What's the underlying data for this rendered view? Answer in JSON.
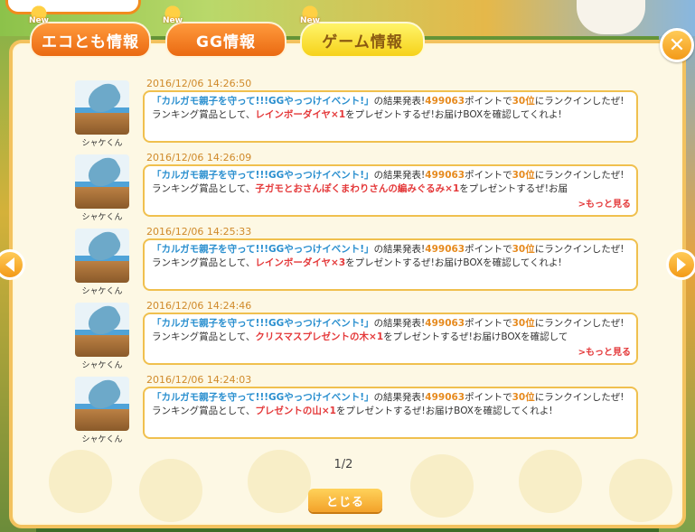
{
  "tabs": [
    {
      "label": "エコとも情報",
      "new": "New"
    },
    {
      "label": "GG情報",
      "new": "New"
    },
    {
      "label": "ゲーム情報",
      "new": "New"
    }
  ],
  "messages": [
    {
      "timestamp": "2016/12/06 14:26:50",
      "sender": "シャケくん",
      "event": "「カルガモ親子を守って!!!GGやっつけイベント!」",
      "text1": "の結果発表!",
      "points": "499063",
      "text2": "ポイントで",
      "rank": "30位",
      "text3": "にランクインしたぜ!",
      "text4": "ランキング賞品として、",
      "prize": "レインボーダイヤ×1",
      "text5": "をプレゼントするぜ!お届けBOXを確認してくれよ!",
      "more": ""
    },
    {
      "timestamp": "2016/12/06 14:26:09",
      "sender": "シャケくん",
      "event": "「カルガモ親子を守って!!!GGやっつけイベント!」",
      "text1": "の結果発表!",
      "points": "499063",
      "text2": "ポイントで",
      "rank": "30位",
      "text3": "にランクインしたぜ!",
      "text4": "ランキング賞品として、",
      "prize": "子ガモとおさんぽくまわりさんの編みぐるみ×1",
      "text5": "をプレゼントするぜ!お届",
      "more": ">もっと見る"
    },
    {
      "timestamp": "2016/12/06 14:25:33",
      "sender": "シャケくん",
      "event": "「カルガモ親子を守って!!!GGやっつけイベント!」",
      "text1": "の結果発表!",
      "points": "499063",
      "text2": "ポイントで",
      "rank": "30位",
      "text3": "にランクインしたぜ!",
      "text4": "ランキング賞品として、",
      "prize": "レインボーダイヤ×3",
      "text5": "をプレゼントするぜ!お届けBOXを確認してくれよ!",
      "more": ""
    },
    {
      "timestamp": "2016/12/06 14:24:46",
      "sender": "シャケくん",
      "event": "「カルガモ親子を守って!!!GGやっつけイベント!」",
      "text1": "の結果発表!",
      "points": "499063",
      "text2": "ポイントで",
      "rank": "30位",
      "text3": "にランクインしたぜ!",
      "text4": "ランキング賞品として、",
      "prize": "クリスマスプレゼントの木×1",
      "text5": "をプレゼントするぜ!お届けBOXを確認して",
      "more": ">もっと見る"
    },
    {
      "timestamp": "2016/12/06 14:24:03",
      "sender": "シャケくん",
      "event": "「カルガモ親子を守って!!!GGやっつけイベント!」",
      "text1": "の結果発表!",
      "points": "499063",
      "text2": "ポイントで",
      "rank": "30位",
      "text3": "にランクインしたぜ!",
      "text4": "ランキング賞品として、",
      "prize": "プレゼントの山×1",
      "text5": "をプレゼントするぜ!お届けBOXを確認してくれよ!",
      "more": ""
    }
  ],
  "pager": "1/2",
  "close_button": "とじる",
  "colors": {
    "accent": "#f39a18",
    "event": "#2a8fcf",
    "prize": "#e4393a",
    "number": "#e68a1e"
  }
}
